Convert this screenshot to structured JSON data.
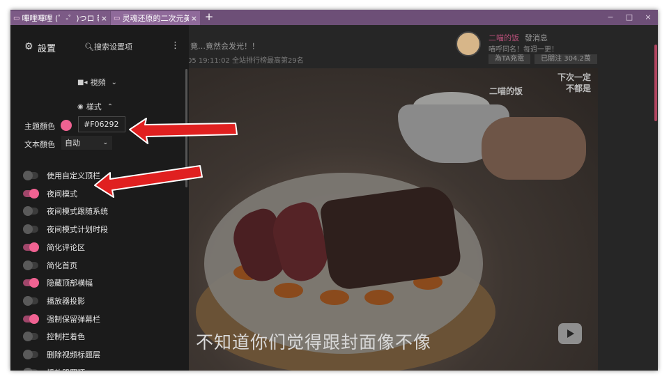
{
  "tabs": [
    {
      "title": "嗶哩嗶哩 (゜-゜)つロ 乾",
      "close": "×"
    },
    {
      "title": "灵魂还原的二次元美",
      "close": "×"
    }
  ],
  "new_tab": "+",
  "window_controls": {
    "minimize": "−",
    "maximize": "□",
    "close": "×"
  },
  "video": {
    "title": "竟…竟然会发光！！",
    "meta": "05 19:11:02  全站排行榜最高第29名",
    "subtitle": "不知道你们觉得跟封面像不像",
    "watermark_line1": "下次一定",
    "watermark_line2": "二喵的饭",
    "watermark_line3": "不都是"
  },
  "uploader": {
    "name": "二喵的饭",
    "message": "發消息",
    "desc": "喵呼同名！每週一更！",
    "charge": "為TA充電",
    "follow": "已關注 304.2萬"
  },
  "panel": {
    "title": "設置",
    "search_placeholder": "搜索设置项",
    "more": "⋮",
    "section_video": "視頻",
    "section_style": "樣式",
    "theme_color_label": "主題顏色",
    "theme_color_value": "#F06292",
    "text_color_label": "文本顏色",
    "text_color_value": "自动",
    "toggles": [
      {
        "label": "使用自定义顶栏",
        "on": false
      },
      {
        "label": "夜间模式",
        "on": true
      },
      {
        "label": "夜间模式跟随系统",
        "on": false
      },
      {
        "label": "夜间模式计划时段",
        "on": false
      },
      {
        "label": "简化评论区",
        "on": true
      },
      {
        "label": "简化首页",
        "on": false
      },
      {
        "label": "隐藏顶部横幅",
        "on": true
      },
      {
        "label": "播放器投影",
        "on": false
      },
      {
        "label": "强制保留弹幕栏",
        "on": true
      },
      {
        "label": "控制栏着色",
        "on": false
      },
      {
        "label": "删除视频标题层",
        "on": false
      },
      {
        "label": "播放器置顶",
        "on": false
      }
    ]
  },
  "colors": {
    "accent": "#F06292",
    "annotation_arrow": "#e02020"
  }
}
